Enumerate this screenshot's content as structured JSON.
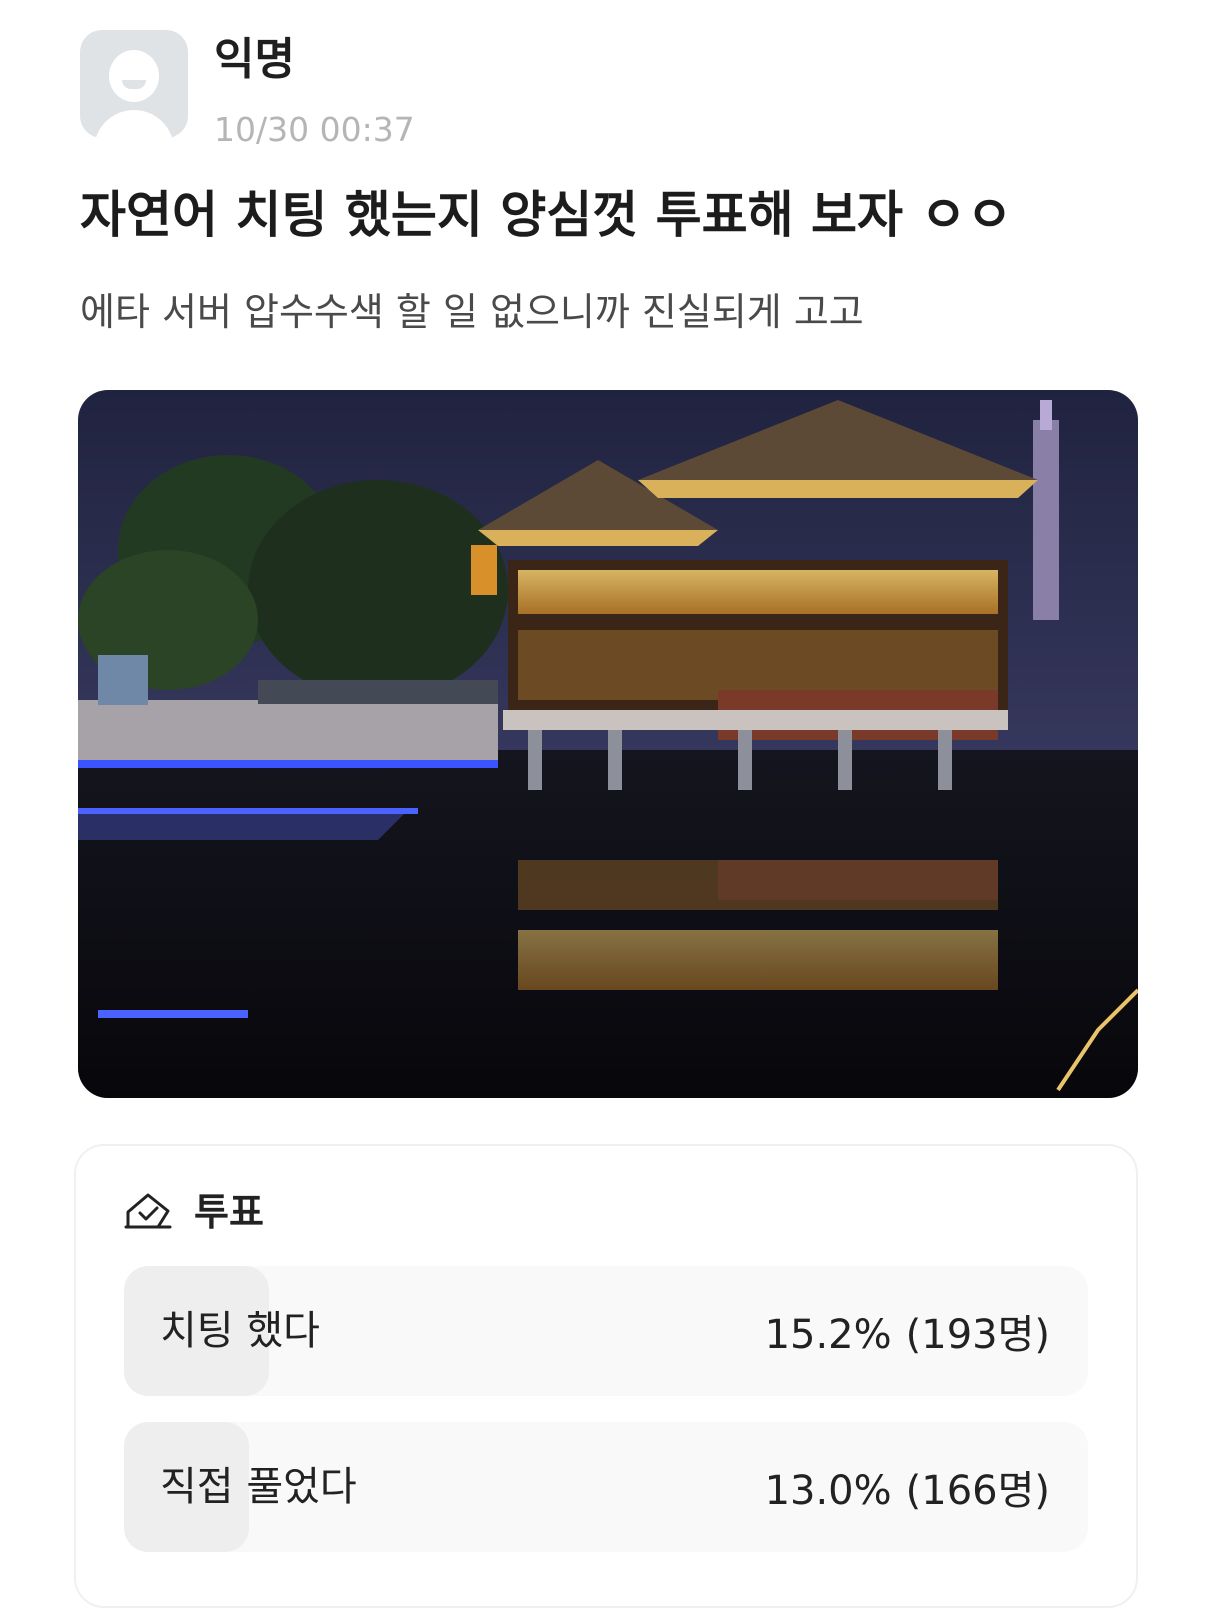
{
  "post": {
    "author": "익명",
    "timestamp": "10/30 00:37",
    "title": "자연어 치팅 했는지 양심껏 투표해 보자 ㅇㅇ",
    "body": "에타 서버 압수수색 할 일 없으니까 진실되게 고고",
    "avatar_icon": "default-avatar-icon",
    "image_icon": "photo-night-pavilion"
  },
  "poll": {
    "icon": "vote-box-icon",
    "title": "투표",
    "options": [
      {
        "label": "치팅 했다",
        "percent": "15.2%",
        "count": "(193명)",
        "share": 0.152
      },
      {
        "label": "직접 풀었다",
        "percent": "13.0%",
        "count": "(166명)",
        "share": 0.13
      }
    ]
  }
}
